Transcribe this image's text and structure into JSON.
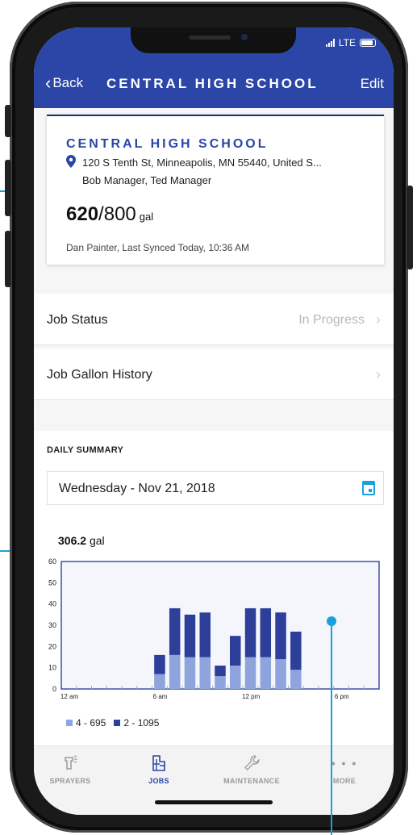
{
  "status_bar": {
    "network": "LTE"
  },
  "nav": {
    "back_label": "Back",
    "title": "CENTRAL HIGH SCHOOL",
    "edit_label": "Edit"
  },
  "job": {
    "name": "CENTRAL HIGH SCHOOL",
    "address": "120 S Tenth St, Minneapolis, MN 55440, United S...",
    "managers": "Bob Manager, Ted Manager",
    "gallons_current": "620",
    "gallons_total": "/800",
    "gallons_unit": "gal",
    "sync_info": "Dan Painter, Last Synced Today, 10:36 AM"
  },
  "rows": [
    {
      "label": "Job Status",
      "value": "In Progress"
    },
    {
      "label": "Job Gallon History",
      "value": ""
    }
  ],
  "daily_summary": {
    "title": "DAILY SUMMARY",
    "date": "Wednesday - Nov 21, 2018",
    "total_value": "306.2",
    "total_unit": "gal"
  },
  "colors": {
    "brand": "#2b46a6",
    "accent": "#1aa0dc",
    "series_light": "#8fa4dc",
    "series_dark": "#2e3f9a"
  },
  "chart_data": {
    "type": "bar",
    "stacked": true,
    "x": [
      6.5,
      7.5,
      8.5,
      9.5,
      10.5,
      11.5,
      12.5,
      13.5,
      14.5,
      15.5
    ],
    "series": [
      {
        "name": "4 - 695",
        "color": "#8fa4dc",
        "values": [
          7,
          16,
          15,
          15,
          6,
          11,
          15,
          15,
          14,
          9
        ]
      },
      {
        "name": "2 - 1095",
        "color": "#2e3f9a",
        "values": [
          9,
          22,
          20,
          21,
          5,
          14,
          23,
          23,
          22,
          18
        ]
      }
    ],
    "xlim": [
      0,
      21
    ],
    "ylim": [
      0,
      60
    ],
    "yticks": [
      0,
      10,
      20,
      30,
      40,
      50,
      60
    ],
    "xtick_labels": [
      {
        "x": 0,
        "label": "12 am"
      },
      {
        "x": 6,
        "label": "6 am"
      },
      {
        "x": 12,
        "label": "12 pm"
      },
      {
        "x": 18,
        "label": "6 pm"
      }
    ],
    "legend_position": "bottom-left",
    "grid": false
  },
  "tabs": [
    {
      "label": "SPRAYERS",
      "icon": "sprayer-icon",
      "active": false
    },
    {
      "label": "JOBS",
      "icon": "jobs-icon",
      "active": true
    },
    {
      "label": "MAINTENANCE",
      "icon": "wrench-icon",
      "active": false
    },
    {
      "label": "MORE",
      "icon": "more-icon",
      "active": false
    }
  ]
}
